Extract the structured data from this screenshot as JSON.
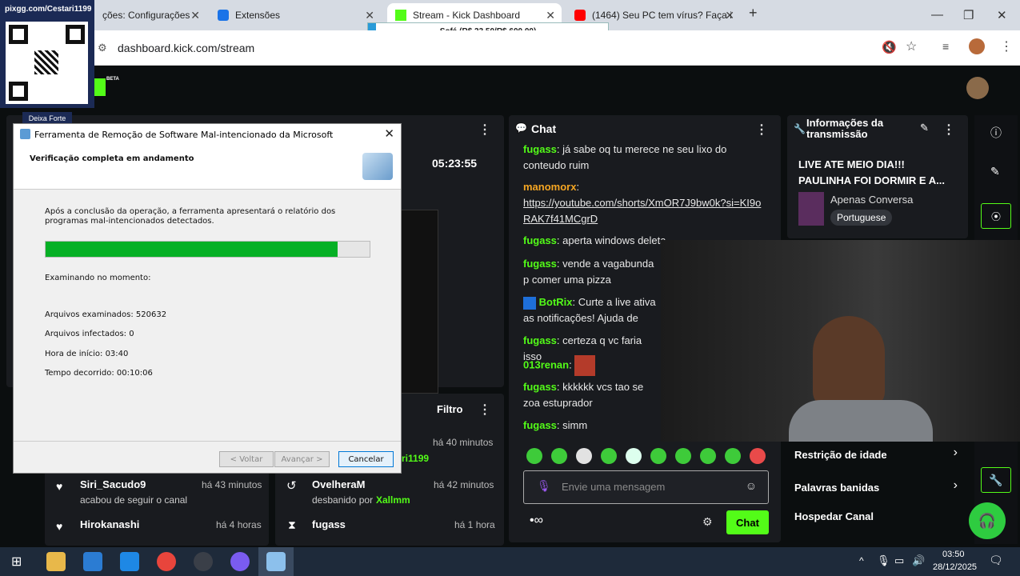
{
  "browser": {
    "tabs": [
      {
        "label": "ções: Configurações"
      },
      {
        "label": "Extensões"
      },
      {
        "label": "Stream - Kick Dashboard"
      },
      {
        "label": "(1464) Seu PC tem vírus? Faça i"
      }
    ],
    "new_tab": "+",
    "url": "dashboard.kick.com/stream",
    "popup_text": "Sofá (R$ 23,50/R$ 600,00)"
  },
  "overlay": {
    "qr_title": "pixgg.com/Cestari1199",
    "qr_caption": "Deixa Forte",
    "beta": "BETA"
  },
  "stream_panel": {
    "timer": "05:23:55"
  },
  "chat": {
    "title": "Chat",
    "messages": [
      {
        "user": "fugass",
        "text": "já sabe oq tu merece ne seu lixo do conteudo ruim"
      },
      {
        "user": "manomorx",
        "text": "https://youtube.com/shorts/XmOR7J9bw0k?si=KI9oRAK7f41MCgrD"
      },
      {
        "user": "fugass",
        "text": "aperta windows deleta"
      },
      {
        "user": "fugass",
        "text": "vende a vagabunda p comer uma pizza"
      },
      {
        "user": "BotRix",
        "text": "Curte a live ativa as notificações! Ajuda de"
      },
      {
        "user": "fugass",
        "text": "certeza q vc faria isso"
      },
      {
        "user": "013renan",
        "text": ""
      },
      {
        "user": "fugass",
        "text": "kkkkkk vcs tao se zoa estuprador"
      },
      {
        "user": "fugass",
        "text": "simm"
      }
    ],
    "input_placeholder": "Envie uma mensagem",
    "send_label": "Chat"
  },
  "info": {
    "title": "Informações da transmissão",
    "stream_title": "LIVE ATE MEIO DIA!!! PAULINHA FOI DORMIR E A...",
    "category": "Apenas Conversa",
    "language": "Portuguese",
    "settings": [
      {
        "label": "Restrição de idade"
      },
      {
        "label": "Palavras banidas"
      },
      {
        "label": "Hospedar Canal"
      }
    ]
  },
  "activity": {
    "filter_label": "Filtro",
    "left_items": [
      {
        "name": "Siri_Sacudo9",
        "time": "há 43 minutos",
        "desc": "acabou de seguir o canal"
      },
      {
        "name": "Hirokanashi",
        "time": "há 4 horas",
        "desc": ""
      }
    ],
    "right_items": [
      {
        "name": "",
        "time": "há 40 minutos",
        "desc": "ri1199"
      },
      {
        "name": "OvelheraM",
        "time": "há 42 minutos",
        "desc": "desbanido por",
        "actor": "Xallmm"
      },
      {
        "name": "fugass",
        "time": "há 1 hora",
        "desc": ""
      }
    ]
  },
  "dialog": {
    "title": "Ferramenta de Remoção de Software Mal-intencionado da Microsoft",
    "header": "Verificação completa  em andamento",
    "info": "Após a conclusão da operação, a ferramenta apresentará o relatório dos programas mal-intencionados detectados.",
    "progress": 0.902,
    "scanning_label": "Examinando no momento:",
    "files_scanned": "Arquivos examinados: 520632",
    "files_infected": "Arquivos infectados: 0",
    "start_time": "Hora de início: 03:40",
    "elapsed": "Tempo decorrido: 00:10:06",
    "back": "< Voltar",
    "next": "Avançar >",
    "cancel": "Cancelar"
  },
  "taskbar": {
    "time": "03:50",
    "date": "28/12/2025"
  }
}
